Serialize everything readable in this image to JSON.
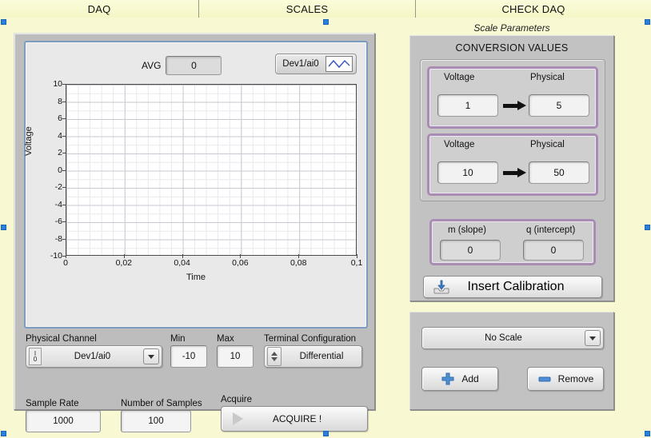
{
  "tabs": [
    {
      "label": "DAQ"
    },
    {
      "label": "SCALES"
    },
    {
      "label": "CHECK DAQ"
    }
  ],
  "daq_panel": {
    "avg": {
      "label": "AVG",
      "value": "0"
    },
    "legend": {
      "name": "Dev1/ai0",
      "icon": "plot-line-icon"
    },
    "physical_channel": {
      "label": "Physical Channel",
      "value": "Dev1/ai0",
      "icon": "io-icon"
    },
    "min": {
      "label": "Min",
      "value": "-10"
    },
    "max": {
      "label": "Max",
      "value": "10"
    },
    "terminal_configuration": {
      "label": "Terminal Configuration",
      "value": "Differential"
    },
    "sample_rate": {
      "label": "Sample Rate",
      "value": "1000"
    },
    "number_of_samples": {
      "label": "Number of Samples",
      "value": "100"
    },
    "acquire": {
      "label": "Acquire",
      "button_label": "ACQUIRE !",
      "icon": "play-icon"
    }
  },
  "chart_data": {
    "type": "line",
    "title": "",
    "xlabel": "Time",
    "ylabel": "Voltage",
    "xlim": [
      0,
      0.1
    ],
    "ylim": [
      -10,
      10
    ],
    "xticks": [
      "0",
      "0,02",
      "0,04",
      "0,06",
      "0,08",
      "0,1"
    ],
    "xtick_values": [
      0,
      0.02,
      0.04,
      0.06,
      0.08,
      0.1
    ],
    "yticks": [
      "10",
      "8",
      "6",
      "4",
      "2",
      "0",
      "-2",
      "-4",
      "-6",
      "-8",
      "-10"
    ],
    "ytick_values": [
      10,
      8,
      6,
      4,
      2,
      0,
      -2,
      -4,
      -6,
      -8,
      -10
    ],
    "grid": true,
    "legend_position": "top-right",
    "series": [
      {
        "name": "Dev1/ai0",
        "color": "#2255cc",
        "x": [],
        "y": []
      }
    ]
  },
  "scales_panel": {
    "title": "Scale Parameters",
    "conversion_header": "CONVERSION VALUES",
    "conversions": [
      {
        "voltage_label": "Voltage",
        "voltage_value": "1",
        "physical_label": "Physical",
        "physical_value": "5"
      },
      {
        "voltage_label": "Voltage",
        "voltage_value": "10",
        "physical_label": "Physical",
        "physical_value": "50"
      }
    ],
    "slope": {
      "label": "m (slope)",
      "value": "0"
    },
    "intercept": {
      "label": "q (intercept)",
      "value": "0"
    },
    "insert_calibration": {
      "label": "Insert Calibration",
      "icon": "insert-calibration-icon"
    },
    "scale_select": {
      "value": "No Scale"
    },
    "add_button": {
      "label": "Add",
      "icon": "plus-icon"
    },
    "remove_button": {
      "label": "Remove",
      "icon": "minus-icon"
    }
  },
  "colors": {
    "background": "#f8f9d3",
    "panel": "#c2c2c2",
    "accent_purple": "#a98cb3",
    "graph_border": "#7d9dc0",
    "selection_handle": "#2a7fdd",
    "icon_blue": "#3d7cc9"
  }
}
